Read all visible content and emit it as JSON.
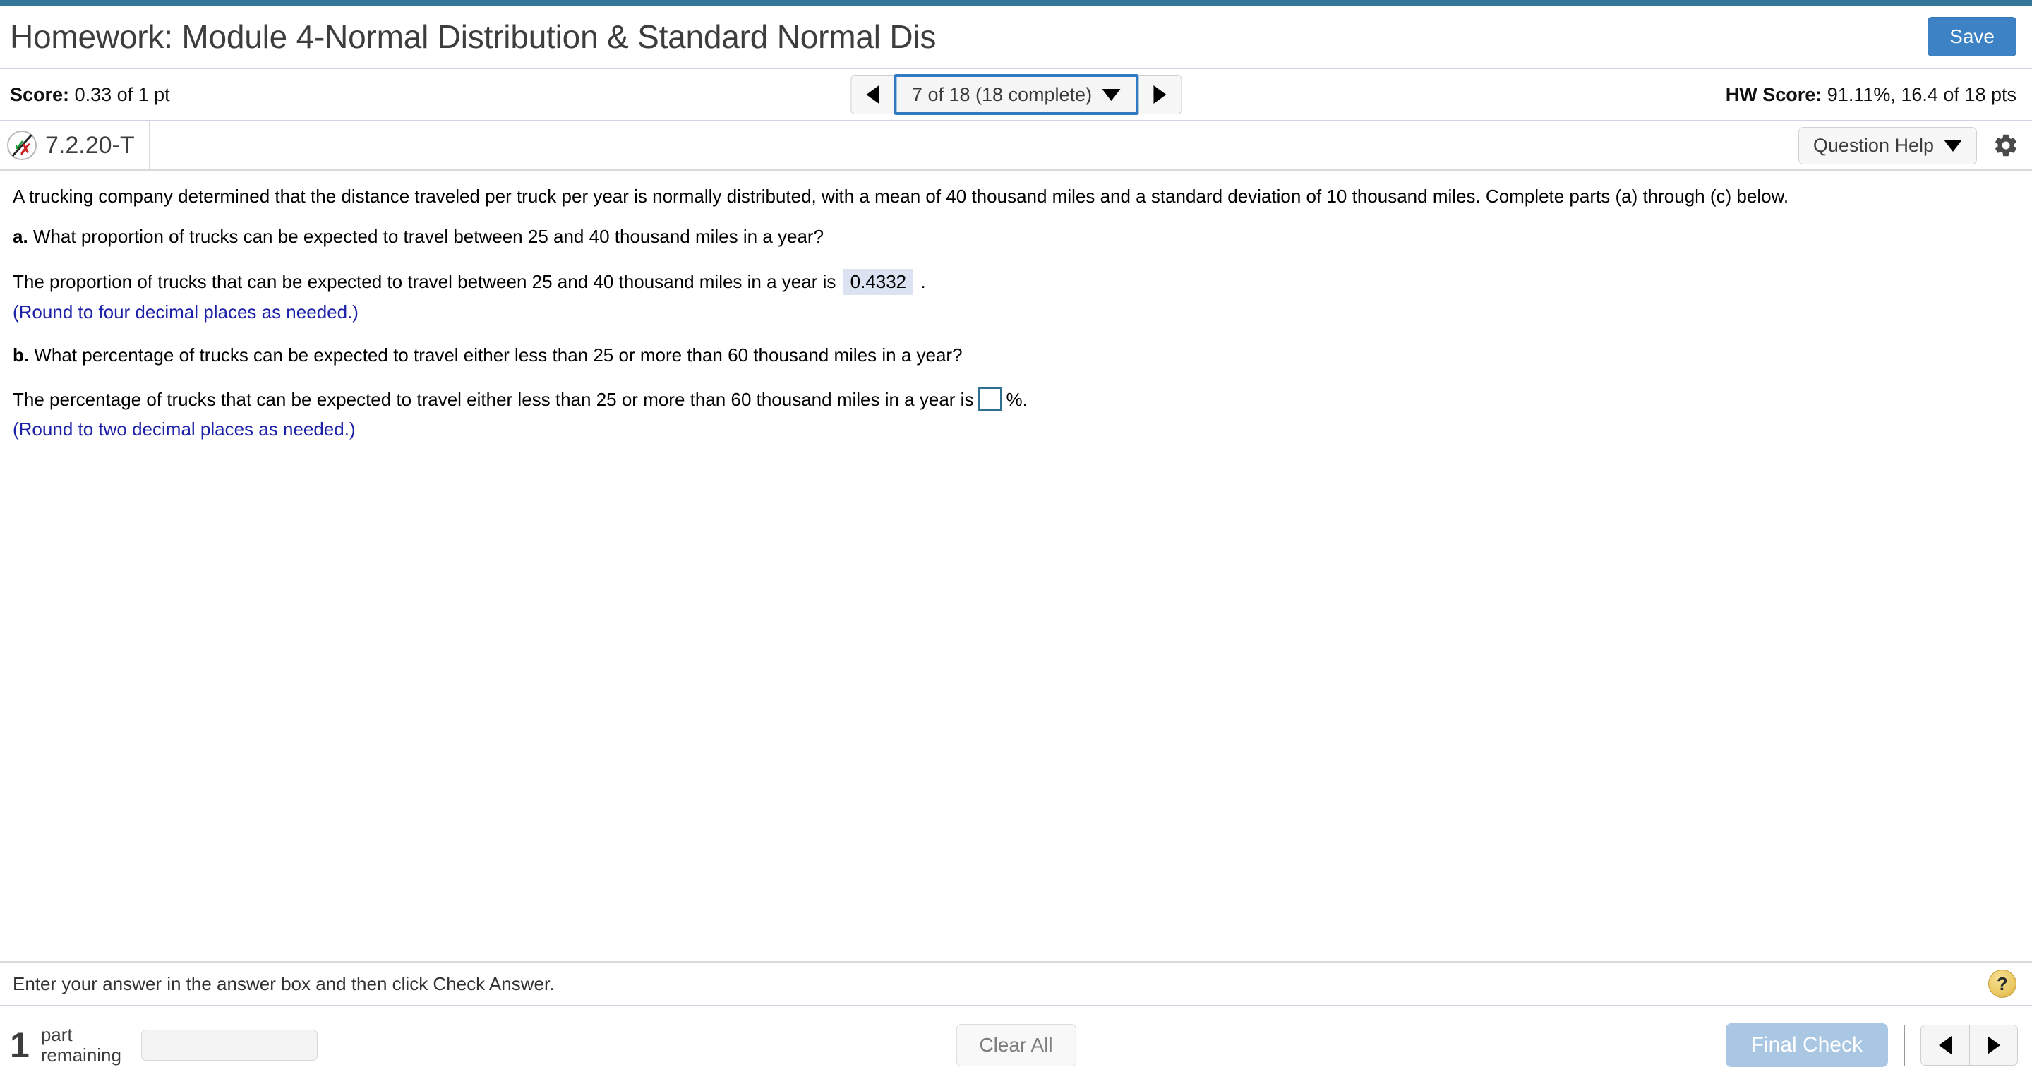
{
  "header": {
    "title": "Homework: Module 4-Normal Distribution & Standard Normal Dis",
    "save_label": "Save",
    "accent_color": "#33789a"
  },
  "score_bar": {
    "score_label": "Score:",
    "score_value": "0.33 of 1 pt",
    "prev_icon": "triangle-left-icon",
    "next_icon": "triangle-right-icon",
    "question_selector": "7 of 18 (18 complete)",
    "hw_score_label": "HW Score:",
    "hw_score_value": "91.11%, 16.4 of 18 pts"
  },
  "question_bar": {
    "status_icon": "partially-correct-icon",
    "question_id": "7.2.20-T",
    "question_help_label": "Question Help",
    "gear_icon": "gear-icon"
  },
  "question": {
    "stem": "A trucking company determined that the distance traveled per truck per year is normally distributed, with a mean of 40 thousand miles and a standard deviation of 10 thousand miles. Complete parts (a) through (c) below.",
    "part_a": {
      "label": "a.",
      "prompt": "What proportion of trucks can be expected to travel between 25 and 40 thousand miles in a year?",
      "answer_prefix": "The proportion of trucks that can be expected to travel between 25 and 40 thousand miles in a year is",
      "answer_value": "0.4332",
      "answer_suffix": ".",
      "rounding_note": "(Round to four decimal places as needed.)"
    },
    "part_b": {
      "label": "b.",
      "prompt": "What percentage of trucks can be expected to travel either less than 25 or more than 60 thousand miles in a year?",
      "answer_prefix": "The percentage of trucks that can be expected to travel either less than 25 or more than 60 thousand miles in a year is",
      "answer_value": "",
      "answer_suffix": "%.",
      "rounding_note": "(Round to two decimal places as needed.)"
    }
  },
  "instruction": {
    "text": "Enter your answer in the answer box and then click Check Answer.",
    "help_icon": "question-mark-icon",
    "help_glyph": "?"
  },
  "footer": {
    "parts_count": "1",
    "parts_word_line1": "part",
    "parts_word_line2": "remaining",
    "progress_percent": 66,
    "clear_all_label": "Clear All",
    "final_check_label": "Final Check",
    "prev_icon": "triangle-left-icon",
    "next_icon": "triangle-right-icon"
  }
}
